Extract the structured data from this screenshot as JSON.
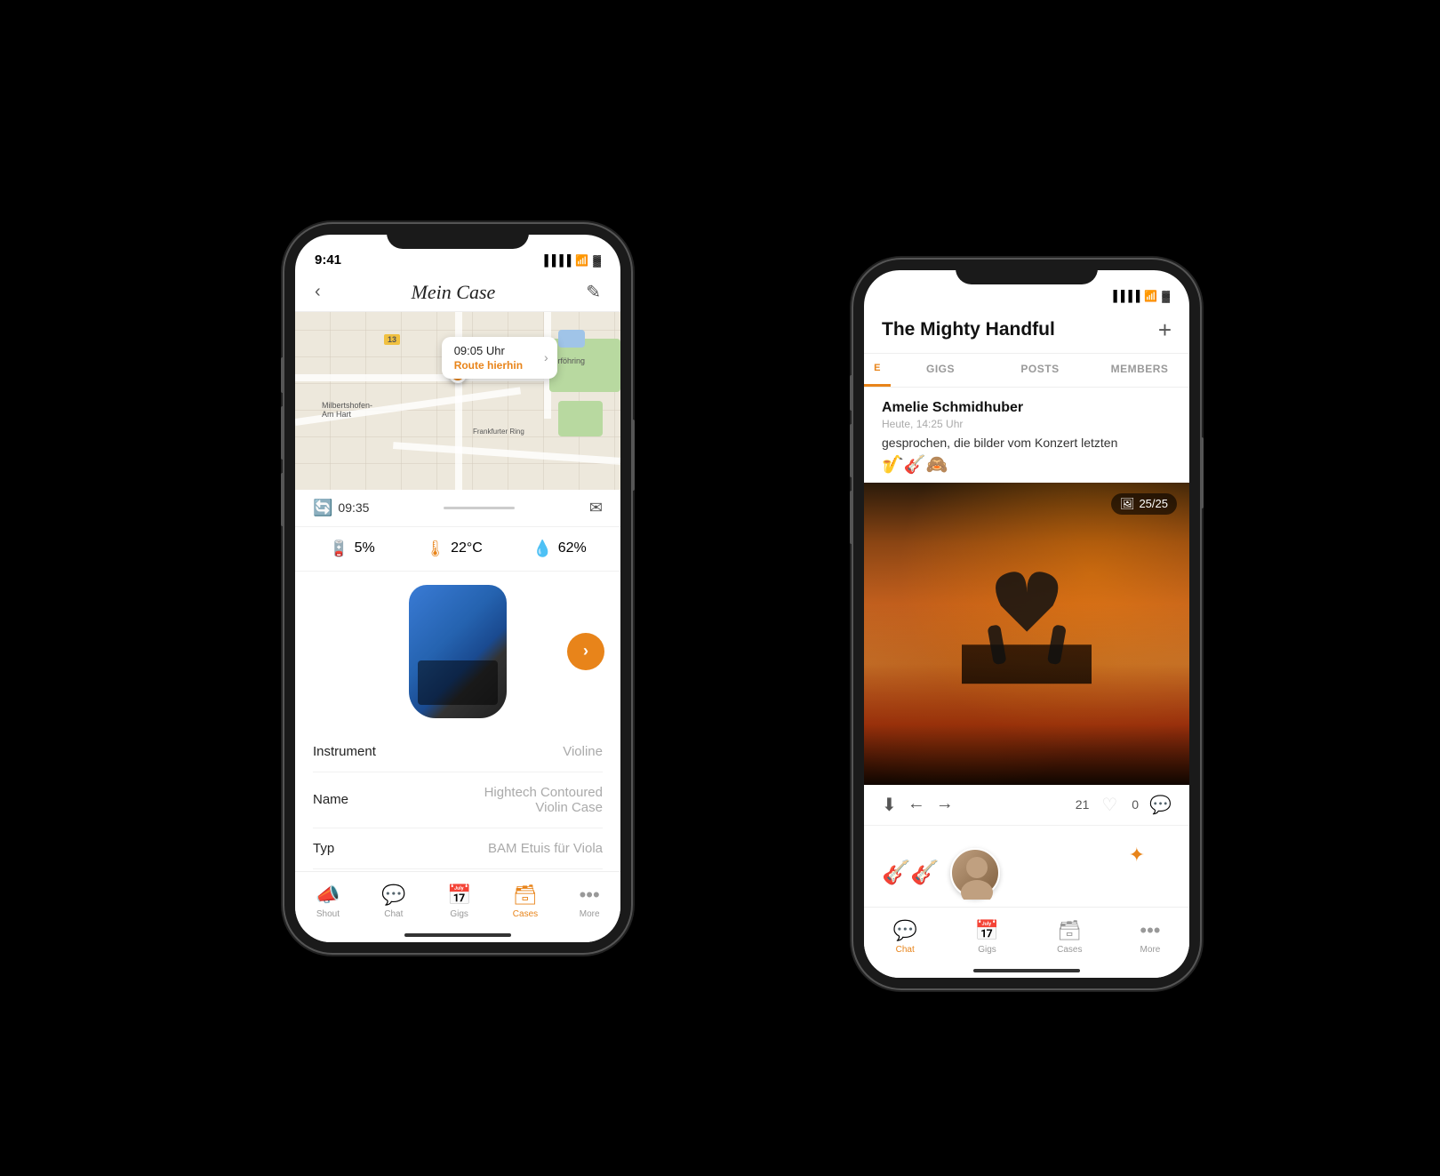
{
  "phone1": {
    "status": {
      "time": "9:41",
      "signal": "●●●●",
      "wifi": "WiFi",
      "battery": "🔋"
    },
    "header": {
      "back_label": "‹",
      "title": "Mein Case",
      "edit_icon": "✎"
    },
    "map": {
      "popup_time": "09:05 Uhr",
      "popup_route": "Route hierhin",
      "label_milbertshofen": "Milbertshofen-\nAm Hart",
      "label_unterfohring": "Unterföhring",
      "label_13": "13"
    },
    "time_bar": {
      "time": "09:35"
    },
    "stats": {
      "battery_pct": "5%",
      "temp": "22°C",
      "humidity": "62%",
      "battery_icon": "🪫",
      "temp_icon": "🌡",
      "humidity_icon": "💧"
    },
    "case": {
      "next_icon": "›"
    },
    "details": [
      {
        "label": "Instrument",
        "value": "Violine"
      },
      {
        "label": "Name",
        "value": "Hightech Contoured\nViolin Case"
      },
      {
        "label": "Typ",
        "value": "BAM Etuis für Viola"
      }
    ],
    "tabs": [
      {
        "id": "shout",
        "icon": "📣",
        "label": "Shout",
        "active": false
      },
      {
        "id": "chat",
        "icon": "💬",
        "label": "Chat",
        "active": false
      },
      {
        "id": "gigs",
        "icon": "📅",
        "label": "Gigs",
        "active": false
      },
      {
        "id": "cases",
        "icon": "🗃",
        "label": "Cases",
        "active": true
      },
      {
        "id": "more",
        "icon": "•••",
        "label": "More",
        "active": false
      }
    ]
  },
  "phone2": {
    "status": {
      "signal": "●●●●",
      "wifi": "WiFi",
      "battery": "🔋"
    },
    "header": {
      "title": "The Mighty Handful",
      "add_icon": "+"
    },
    "tabs": [
      {
        "id": "chat_partial",
        "label": "E",
        "active": true,
        "partial": true
      },
      {
        "id": "gigs",
        "label": "GIGS",
        "active": false
      },
      {
        "id": "posts",
        "label": "POSTS",
        "active": false
      },
      {
        "id": "members",
        "label": "MEMBERS",
        "active": false
      }
    ],
    "post": {
      "author": "Amelie Schmidhuber",
      "time": "Heute, 14:25 Uhr",
      "text": "gesprochen, die bilder vom Konzert letzten",
      "emojis": "🎷🎸🙈",
      "image_counter": "25/25",
      "image_icon": "🖼"
    },
    "actions": {
      "download_icon": "⬇",
      "prev_icon": "←",
      "next_icon": "→",
      "likes": "21",
      "comments": "0",
      "heart_icon": "♡",
      "comment_icon": "💬"
    },
    "bottom": {
      "emoji1": "🎸",
      "emoji2": "🎸",
      "sparkle": "✦"
    },
    "tabs_bottom": [
      {
        "id": "chat",
        "icon": "💬",
        "label": "Chat",
        "active": true
      },
      {
        "id": "gigs",
        "icon": "📅",
        "label": "Gigs",
        "active": false
      },
      {
        "id": "cases",
        "icon": "🗃",
        "label": "Cases",
        "active": false
      },
      {
        "id": "more",
        "icon": "•••",
        "label": "More",
        "active": false
      }
    ]
  }
}
